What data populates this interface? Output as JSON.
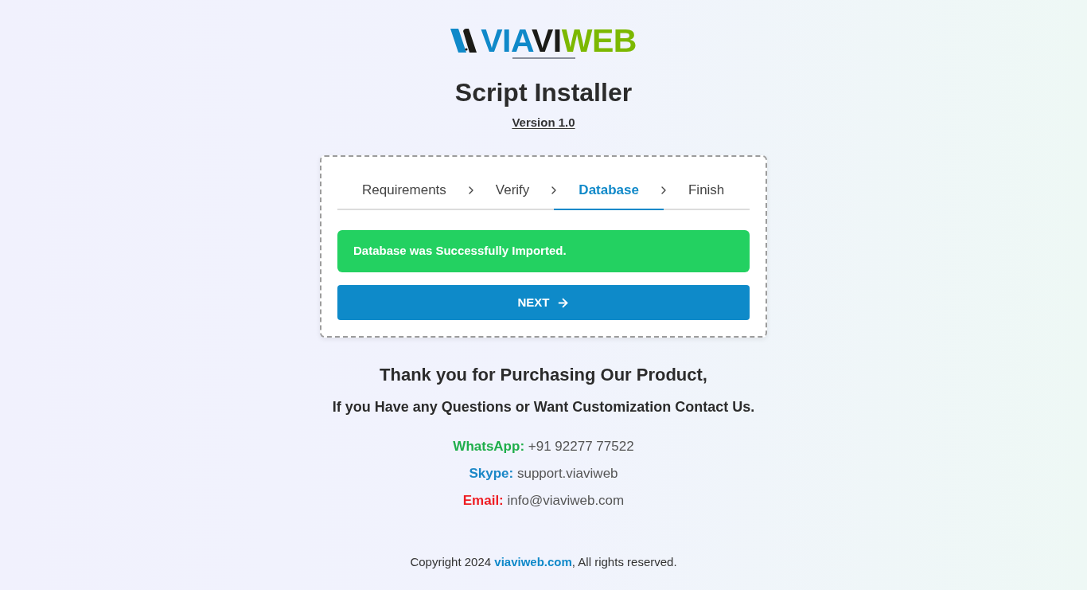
{
  "logo": {
    "parts": [
      {
        "text": "VIA",
        "color": "#1089c9"
      },
      {
        "text": "VI",
        "color": "#1b1b17"
      },
      {
        "text": "WEB",
        "color": "#7cb800"
      }
    ]
  },
  "title": "Script Installer",
  "version": "Version 1.0",
  "steps": [
    {
      "label": "Requirements",
      "selected": false
    },
    {
      "label": "Verify",
      "selected": false
    },
    {
      "label": "Database",
      "selected": true
    },
    {
      "label": "Finish",
      "selected": false
    }
  ],
  "alert": {
    "message": "Database was Successfully Imported."
  },
  "next_button": {
    "label": "NEXT"
  },
  "thanks": {
    "heading": "Thank you for Purchasing Our Product,",
    "subheading": "If you Have any Questions or Want Customization Contact Us."
  },
  "contacts": [
    {
      "label": "WhatsApp:",
      "value": "+91 92277 77522",
      "color": "#1fae4b"
    },
    {
      "label": "Skype:",
      "value": "support.viaviweb",
      "color": "#1b87c7"
    },
    {
      "label": "Email:",
      "value": "info@viaviweb.com",
      "color": "#ee1d23"
    }
  ],
  "footer": {
    "before": "Copyright 2024",
    "link": "viaviweb.com",
    "after": ", All rights reserved."
  }
}
